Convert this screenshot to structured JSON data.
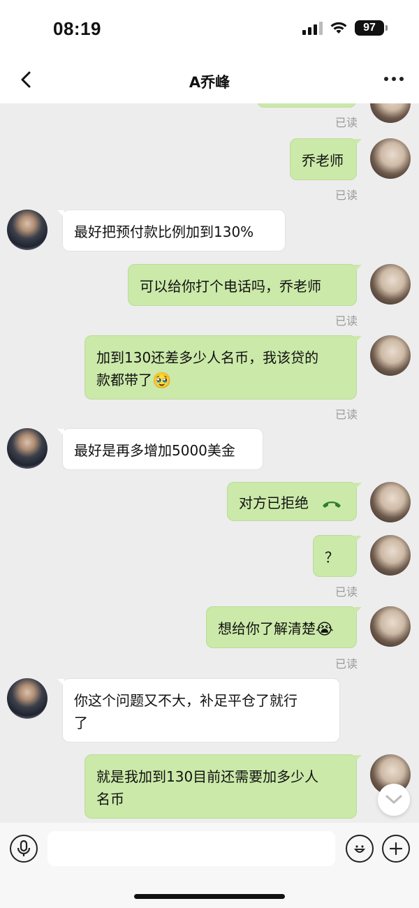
{
  "status_bar": {
    "time": "08:19",
    "battery": "97",
    "icons": [
      "signal-icon",
      "wifi-icon",
      "battery-icon"
    ]
  },
  "nav": {
    "title": "A乔峰",
    "back_icon": "chevron-left-icon",
    "more_icon": "more-dots-icon"
  },
  "messages": [
    {
      "from": "me",
      "read_label": "已读"
    },
    {
      "from": "me",
      "text": "乔老师",
      "read_label": "已读"
    },
    {
      "from": "them",
      "text": "最好把预付款比例加到130%"
    },
    {
      "from": "me",
      "text": "可以给你打个电话吗，乔老师",
      "read_label": "已读"
    },
    {
      "from": "me",
      "line1": "加到130还差多少人名币，我该贷的",
      "line2": "款都带了",
      "emoji": "🥹",
      "read_label": "已读"
    },
    {
      "from": "them",
      "text": "最好是再多增加5000美金"
    },
    {
      "from": "me",
      "text": "对方已拒绝",
      "icon": "phone-hangup-icon"
    },
    {
      "from": "me",
      "text": "？",
      "read_label": "已读"
    },
    {
      "from": "me",
      "text": "想给你了解清楚",
      "emoji": "😭",
      "read_label": "已读"
    },
    {
      "from": "them",
      "line1": "你这个问题又不大，补足平仓了就行",
      "line2": "了"
    },
    {
      "from": "me",
      "line1": "就是我加到130目前还需要加多少人",
      "line2": "名币"
    }
  ],
  "colors": {
    "my_bubble": "#cbe9a9",
    "their_bubble": "#ffffff",
    "chat_background": "#ededed"
  },
  "input_bar": {
    "voice_icon": "microphone-icon",
    "emoji_icon": "emoji-smile-icon",
    "add_icon": "plus-icon",
    "placeholder": ""
  },
  "scroll_down_icon": "chevron-down-icon"
}
